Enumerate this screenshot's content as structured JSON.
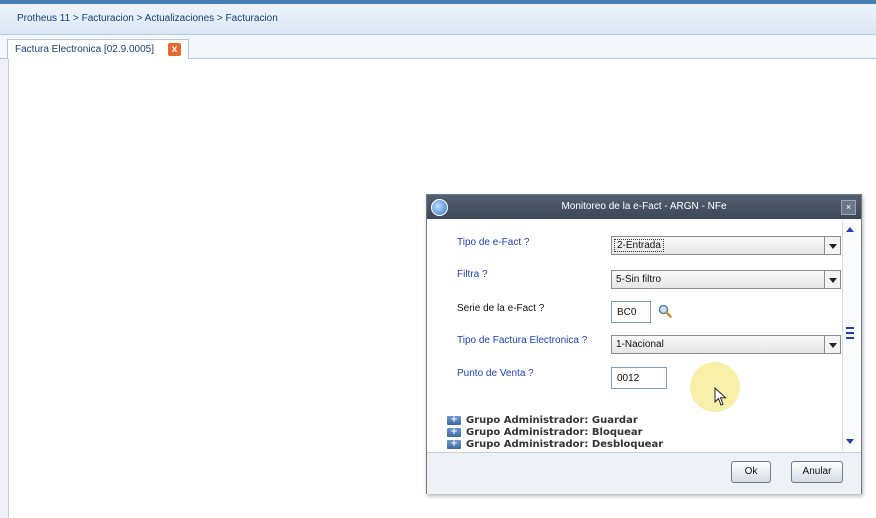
{
  "breadcrumb": "Protheus 11 > Facturacion > Actualizaciones > Facturacion",
  "tab": {
    "label": "Factura Electronica [02.9.0005]",
    "close": "x"
  },
  "dialog": {
    "title": "Monitoreo de la e-Fact - ARGN - NFe",
    "fields": {
      "tipo_efact": {
        "label": "Tipo de e-Fact ?",
        "value": "2-Entrada"
      },
      "filtra": {
        "label": "Filtra ?",
        "value": "5-Sin filtro"
      },
      "serie": {
        "label": "Serie de la e-Fact ?",
        "value": "BC0"
      },
      "tipo_factura": {
        "label": "Tipo de Factura Electronica ?",
        "value": "1-Nacional"
      },
      "punto_venta": {
        "label": "Punto de Venta ?",
        "value": "0012"
      }
    },
    "tree": [
      {
        "label": "Grupo Administrador: Guardar"
      },
      {
        "label": "Grupo Administrador: Bloquear"
      },
      {
        "label": "Grupo Administrador: Desbloquear"
      }
    ],
    "buttons": {
      "ok": "Ok",
      "cancel": "Anular"
    }
  },
  "icons": {
    "app": "app-logo-icon",
    "close": "close-icon",
    "search": "search-icon",
    "expand": "expand-plus-icon",
    "cursor": "mouse-pointer-icon"
  },
  "colors": {
    "title_bar": "#3c4856",
    "label_blue": "#1e3fbf",
    "tab_close": "#e8692c"
  }
}
